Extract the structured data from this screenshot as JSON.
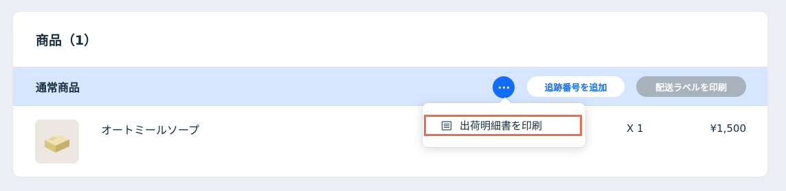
{
  "header": {
    "title": "商品（1）"
  },
  "section": {
    "title": "通常商品",
    "more_icon": "ellipsis-icon",
    "tracking_button": "追跡番号を追加",
    "shipping_label_button": "配送ラベルを印刷"
  },
  "product": {
    "name": "オートミールソープ",
    "quantity": "X 1",
    "price": "¥1,500"
  },
  "menu": {
    "item_icon": "document-list-icon",
    "print_packing_slip": "出荷明細書を印刷"
  },
  "colors": {
    "accent": "#116dff",
    "section_bg": "#d6e6fe",
    "highlight_border": "#ee6b4d",
    "disabled_pill": "#a8b2bd"
  }
}
